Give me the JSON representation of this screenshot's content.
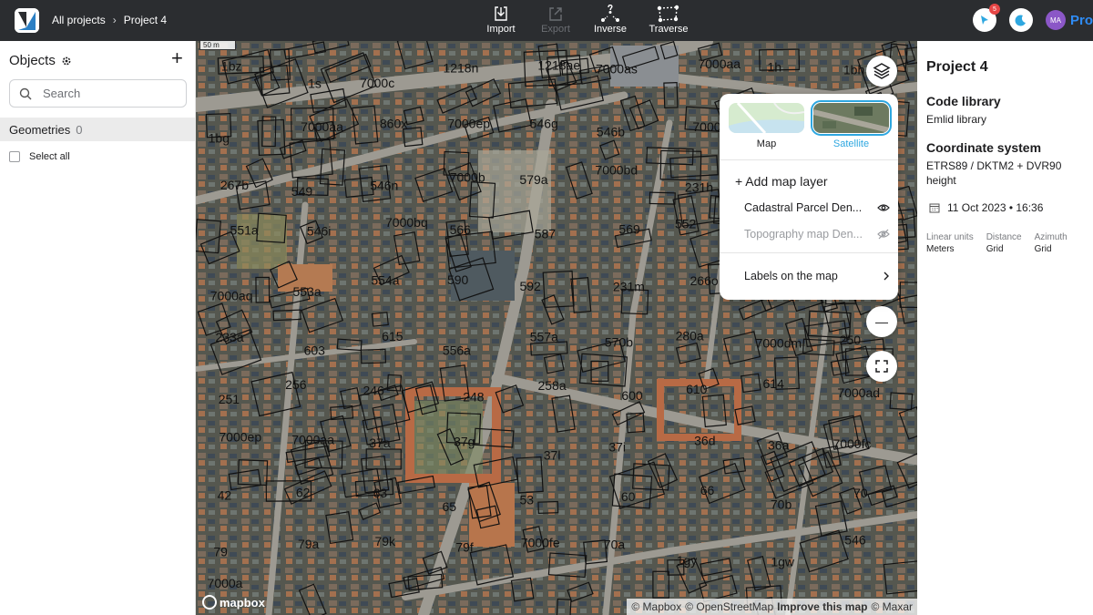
{
  "topbar": {
    "breadcrumb": {
      "root": "All projects",
      "separator": "›",
      "current": "Project 4"
    },
    "tools": [
      {
        "label": "Import",
        "icon": "import-icon",
        "enabled": true
      },
      {
        "label": "Export",
        "icon": "export-icon",
        "enabled": false
      },
      {
        "label": "Inverse",
        "icon": "inverse-icon",
        "enabled": true
      },
      {
        "label": "Traverse",
        "icon": "traverse-icon",
        "enabled": true
      }
    ],
    "notification_count": "5",
    "avatar_initials": "MA",
    "plan_label": "Pro"
  },
  "objects_panel": {
    "title": "Objects",
    "add_symbol": "+",
    "search_placeholder": "Search",
    "geometries_label": "Geometries",
    "geometries_count": "0",
    "select_all_label": "Select all"
  },
  "map": {
    "scale_label": "50 m",
    "mapbox_label": "mapbox",
    "attribution": {
      "mapbox": "© Mapbox",
      "osm": "© OpenStreetMap",
      "improve": "Improve this map",
      "maxar": "© Maxar"
    },
    "zoom_out": "—",
    "parcel_labels": [
      "1bz",
      "1s",
      "7000c",
      "1218n",
      "1218ae",
      "7000as",
      "7000aa",
      "1h",
      "1bh",
      "1bg",
      "7000aa",
      "860x",
      "7000ep",
      "546g",
      "546b",
      "7000ba",
      "7000ar",
      "231v",
      "267b",
      "549",
      "546n",
      "7000b",
      "579a",
      "7000bd",
      "231h",
      "231a",
      "266m",
      "551a",
      "546i",
      "7000bq",
      "566",
      "587",
      "569",
      "552",
      "586",
      "563",
      "7000aq",
      "553a",
      "554a",
      "590",
      "592",
      "231m",
      "266o",
      "262a",
      "232a",
      "233a",
      "603",
      "615",
      "556a",
      "557a",
      "570b",
      "280a",
      "7000dm",
      "250",
      "251",
      "256",
      "246",
      "248",
      "258a",
      "600",
      "610",
      "614",
      "7000ad",
      "7000ep",
      "7000aa",
      "37a",
      "37g",
      "37l",
      "37i",
      "36d",
      "36a",
      "7000fc",
      "42",
      "62",
      "63",
      "65",
      "53",
      "60",
      "66",
      "70b",
      "70",
      "79",
      "79a",
      "79k",
      "79f",
      "7000fe",
      "70a",
      "1gy",
      "1gw",
      "546",
      "7000a"
    ]
  },
  "layers_popup": {
    "thumbs": [
      {
        "label": "Map",
        "selected": false
      },
      {
        "label": "Satellite",
        "selected": true
      }
    ],
    "add_layer": "+ Add map layer",
    "layers": [
      {
        "name": "Cadastral Parcel Den...",
        "visible": true
      },
      {
        "name": "Topography map Den...",
        "visible": false
      }
    ],
    "labels_on_map": "Labels on the map"
  },
  "project_panel": {
    "title": "Project 4",
    "code_library_heading": "Code library",
    "code_library_value": "Emlid library",
    "coord_heading": "Coordinate system",
    "coord_value": "ETRS89 / DKTM2 + DVR90 height",
    "date": "11 Oct 2023 • 16:36",
    "units": [
      {
        "key": "Linear units",
        "value": "Meters"
      },
      {
        "key": "Distance",
        "value": "Grid"
      },
      {
        "key": "Azimuth",
        "value": "Grid"
      }
    ]
  },
  "colors": {
    "topbar_bg": "#2b2d30",
    "accent": "#2ea7e0",
    "pro_blue": "#2f8cf5",
    "notification": "#e64646",
    "avatar": "#8b57c7"
  }
}
